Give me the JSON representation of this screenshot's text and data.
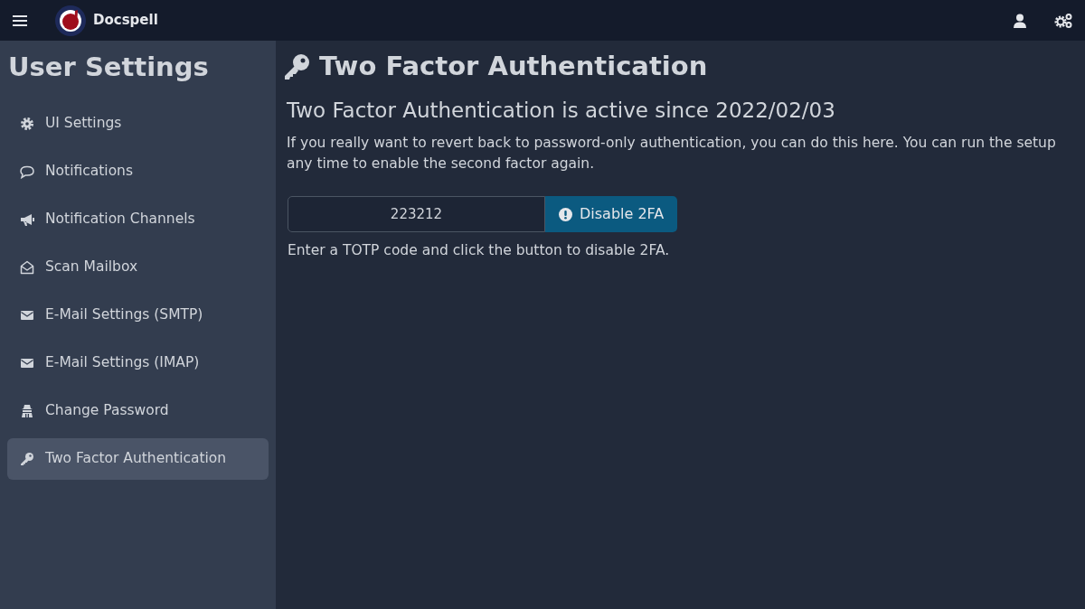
{
  "header": {
    "app_name": "Docspell"
  },
  "sidebar": {
    "title": "User Settings",
    "items": [
      {
        "label": "UI Settings",
        "kind": "gear",
        "selected": false
      },
      {
        "label": "Notifications",
        "kind": "comment",
        "selected": false
      },
      {
        "label": "Notification Channels",
        "kind": "bullhorn",
        "selected": false
      },
      {
        "label": "Scan Mailbox",
        "kind": "inbox",
        "selected": false
      },
      {
        "label": "E-Mail Settings (SMTP)",
        "kind": "envelope",
        "selected": false
      },
      {
        "label": "E-Mail Settings (IMAP)",
        "kind": "envelope",
        "selected": false
      },
      {
        "label": "Change Password",
        "kind": "spy",
        "selected": false
      },
      {
        "label": "Two Factor Authentication",
        "kind": "key",
        "selected": true
      }
    ]
  },
  "main": {
    "title": "Two Factor Authentication",
    "subtitle": "Two Factor Authentication is active since 2022/02/03",
    "description": "If you really want to revert back to password-only authentication, you can do this here. You can run the setup any time to enable the second factor again.",
    "code_field": {
      "value": "223212"
    },
    "button": "Disable 2FA",
    "hint": "Enter a TOTP code and click the button to disable 2FA."
  }
}
